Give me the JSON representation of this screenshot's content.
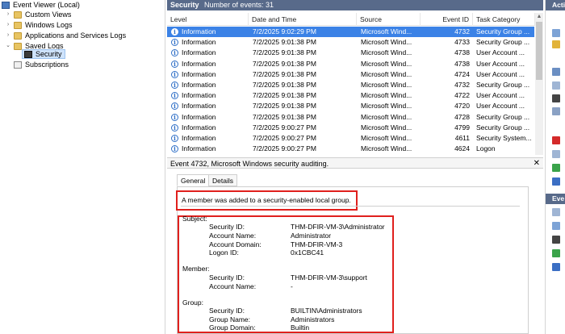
{
  "tree": {
    "root": "Event Viewer (Local)",
    "items": [
      {
        "label": "Custom Views"
      },
      {
        "label": "Windows Logs"
      },
      {
        "label": "Applications and Services Logs"
      },
      {
        "label": "Saved Logs"
      },
      {
        "label": "Security"
      },
      {
        "label": "Subscriptions"
      }
    ]
  },
  "list": {
    "title": "Security",
    "count": "Number of events: 31",
    "columns": [
      "Level",
      "Date and Time",
      "Source",
      "Event ID",
      "Task Category"
    ],
    "rows": [
      {
        "level": "Information",
        "date": "7/2/2025 9:02:29 PM",
        "source": "Microsoft Wind...",
        "id": "4732",
        "task": "Security Group ..."
      },
      {
        "level": "Information",
        "date": "7/2/2025 9:01:38 PM",
        "source": "Microsoft Wind...",
        "id": "4733",
        "task": "Security Group ..."
      },
      {
        "level": "Information",
        "date": "7/2/2025 9:01:38 PM",
        "source": "Microsoft Wind...",
        "id": "4738",
        "task": "User Account ..."
      },
      {
        "level": "Information",
        "date": "7/2/2025 9:01:38 PM",
        "source": "Microsoft Wind...",
        "id": "4738",
        "task": "User Account ..."
      },
      {
        "level": "Information",
        "date": "7/2/2025 9:01:38 PM",
        "source": "Microsoft Wind...",
        "id": "4724",
        "task": "User Account ..."
      },
      {
        "level": "Information",
        "date": "7/2/2025 9:01:38 PM",
        "source": "Microsoft Wind...",
        "id": "4732",
        "task": "Security Group ..."
      },
      {
        "level": "Information",
        "date": "7/2/2025 9:01:38 PM",
        "source": "Microsoft Wind...",
        "id": "4722",
        "task": "User Account ..."
      },
      {
        "level": "Information",
        "date": "7/2/2025 9:01:38 PM",
        "source": "Microsoft Wind...",
        "id": "4720",
        "task": "User Account ..."
      },
      {
        "level": "Information",
        "date": "7/2/2025 9:01:38 PM",
        "source": "Microsoft Wind...",
        "id": "4728",
        "task": "Security Group ..."
      },
      {
        "level": "Information",
        "date": "7/2/2025 9:00:27 PM",
        "source": "Microsoft Wind...",
        "id": "4799",
        "task": "Security Group ..."
      },
      {
        "level": "Information",
        "date": "7/2/2025 9:00:27 PM",
        "source": "Microsoft Wind...",
        "id": "4611",
        "task": "Security System..."
      },
      {
        "level": "Information",
        "date": "7/2/2025 9:00:27 PM",
        "source": "Microsoft Wind...",
        "id": "4624",
        "task": "Logon"
      }
    ]
  },
  "detail": {
    "title": "Event 4732, Microsoft Windows security auditing.",
    "close": "✕",
    "tabs": [
      "General",
      "Details"
    ],
    "message": "A member was added to a security-enabled local group.",
    "subject_heading": "Subject:",
    "subject": [
      {
        "key": "Security ID:",
        "value": "THM-DFIR-VM-3\\Administrator"
      },
      {
        "key": "Account Name:",
        "value": "Administrator"
      },
      {
        "key": "Account Domain:",
        "value": "THM-DFIR-VM-3"
      },
      {
        "key": "Logon ID:",
        "value": "0x1CBC41"
      }
    ],
    "member_heading": "Member:",
    "member": [
      {
        "key": "Security ID:",
        "value": "THM-DFIR-VM-3\\support"
      },
      {
        "key": "Account Name:",
        "value": "-"
      }
    ],
    "group_heading": "Group:",
    "group": [
      {
        "key": "Security ID:",
        "value": "BUILTIN\\Administrators"
      },
      {
        "key": "Group Name:",
        "value": "Administrators"
      },
      {
        "key": "Group Domain:",
        "value": "Builtin"
      }
    ]
  },
  "actions": {
    "head1": "Acti",
    "head2": "Eve"
  },
  "colors": {
    "header_bg": "#586a8a",
    "selected_row": "#3b82e6",
    "highlight_box": "#e0201d"
  }
}
